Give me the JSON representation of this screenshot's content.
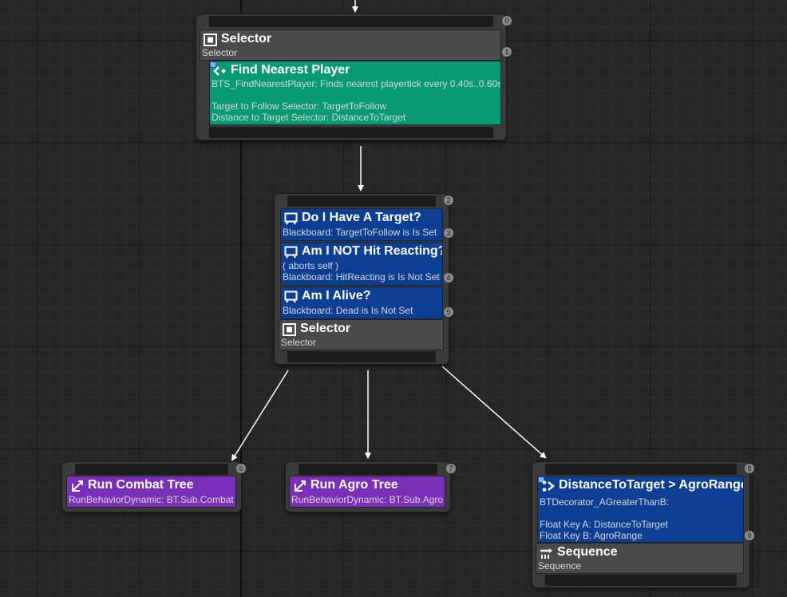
{
  "nodes": {
    "root_selector": {
      "index": "0",
      "selector": {
        "index": "1",
        "title": "Selector",
        "subtitle": "Selector"
      },
      "service": {
        "title": "Find Nearest Player",
        "line1": "BTS_FindNearestPlayer: Finds nearest playertick every 0.40s..0.60s",
        "line2": "Target to Follow Selector: TargetToFollow",
        "line3": "Distance to Target Selector: DistanceToTarget"
      }
    },
    "middle_selector": {
      "index": "2",
      "decorators": [
        {
          "index": "3",
          "title": "Do I Have A Target?",
          "lines": [
            "Blackboard: TargetToFollow is Is Set"
          ]
        },
        {
          "index": "4",
          "title": "Am I NOT Hit Reacting?",
          "lines": [
            "( aborts self )",
            "Blackboard: HitReacting is Is Not Set"
          ]
        },
        {
          "index": "5",
          "title": "Am I Alive?",
          "lines": [
            "Blackboard: Dead is Is Not Set"
          ]
        }
      ],
      "selector": {
        "title": "Selector",
        "subtitle": "Selector"
      }
    },
    "run_combat": {
      "index": "6",
      "title": "Run Combat Tree",
      "subtitle": "RunBehaviorDynamic: BT.Sub.Combat"
    },
    "run_agro": {
      "index": "7",
      "title": "Run Agro Tree",
      "subtitle": "RunBehaviorDynamic: BT.Sub.Agro"
    },
    "sequence_node": {
      "index": "8",
      "decorator": {
        "index": "9",
        "title": "DistanceToTarget > AgroRange",
        "line1": "BTDecorator_AGreaterThanB:",
        "line2": "Float Key A: DistanceToTarget",
        "line3": "Float Key B: AgroRange"
      },
      "sequence": {
        "title": "Sequence",
        "subtitle": "Sequence"
      }
    }
  },
  "colors": {
    "background": "#262626",
    "service": "#089b73",
    "decorator": "#0c3e94",
    "task": "#7a2fb8",
    "composite": "#4a4a4a",
    "node_frame": "#3a3a3a"
  }
}
